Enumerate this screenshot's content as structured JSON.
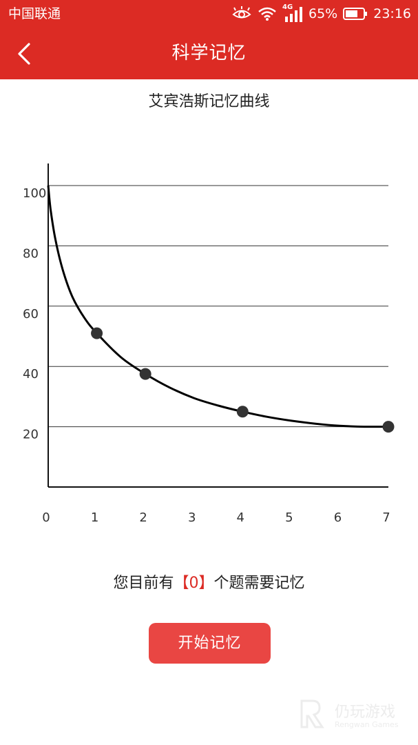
{
  "status_bar": {
    "carrier": "中国联通",
    "network": "4G",
    "battery": "65%",
    "time": "23:16"
  },
  "header": {
    "title": "科学记忆",
    "back_icon": "chevron-left-icon"
  },
  "chart_data": {
    "type": "line",
    "title": "艾宾浩斯记忆曲线",
    "xlabel": "",
    "ylabel": "",
    "x_ticks": [
      "0",
      "1",
      "2",
      "3",
      "4",
      "5",
      "6",
      "7"
    ],
    "y_ticks": [
      "20",
      "40",
      "60",
      "80",
      "100"
    ],
    "xlim": [
      0,
      7
    ],
    "ylim": [
      0,
      105
    ],
    "grid": "horizontal",
    "curve": {
      "x": [
        0,
        0.05,
        0.15,
        0.3,
        0.5,
        0.75,
        1,
        1.5,
        2,
        2.5,
        3,
        3.5,
        4,
        4.5,
        5,
        5.5,
        6,
        6.5,
        7
      ],
      "y": [
        100,
        92,
        82,
        72,
        63,
        56,
        51,
        43,
        37.5,
        33,
        29.5,
        27,
        25,
        23.3,
        22,
        21,
        20.3,
        20,
        20
      ]
    },
    "points": {
      "x": [
        1,
        2,
        4,
        7
      ],
      "y": [
        51,
        37.5,
        25,
        20
      ]
    },
    "line_color": "#000000",
    "point_color": "#333333"
  },
  "summary": {
    "prefix": "您目前有",
    "bracket_open": "【",
    "count": "0",
    "bracket_close": "】",
    "suffix": "个题需要记忆"
  },
  "actions": {
    "start_label": "开始记忆"
  },
  "watermark": {
    "text": "仍玩游戏",
    "sub": "Rengwan Games"
  },
  "colors": {
    "brand": "#dc2b24",
    "button": "#e94643"
  }
}
